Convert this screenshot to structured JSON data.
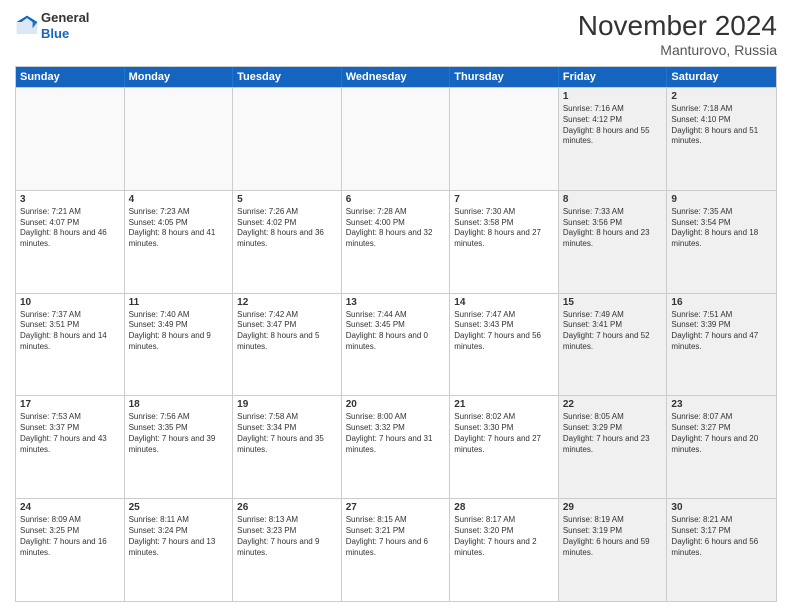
{
  "logo": {
    "general": "General",
    "blue": "Blue"
  },
  "header": {
    "month": "November 2024",
    "location": "Manturovo, Russia"
  },
  "weekdays": [
    "Sunday",
    "Monday",
    "Tuesday",
    "Wednesday",
    "Thursday",
    "Friday",
    "Saturday"
  ],
  "rows": [
    [
      {
        "day": "",
        "sunrise": "",
        "sunset": "",
        "daylight": "",
        "empty": true
      },
      {
        "day": "",
        "sunrise": "",
        "sunset": "",
        "daylight": "",
        "empty": true
      },
      {
        "day": "",
        "sunrise": "",
        "sunset": "",
        "daylight": "",
        "empty": true
      },
      {
        "day": "",
        "sunrise": "",
        "sunset": "",
        "daylight": "",
        "empty": true
      },
      {
        "day": "",
        "sunrise": "",
        "sunset": "",
        "daylight": "",
        "empty": true
      },
      {
        "day": "1",
        "sunrise": "Sunrise: 7:16 AM",
        "sunset": "Sunset: 4:12 PM",
        "daylight": "Daylight: 8 hours and 55 minutes.",
        "empty": false,
        "shaded": true
      },
      {
        "day": "2",
        "sunrise": "Sunrise: 7:18 AM",
        "sunset": "Sunset: 4:10 PM",
        "daylight": "Daylight: 8 hours and 51 minutes.",
        "empty": false,
        "shaded": true
      }
    ],
    [
      {
        "day": "3",
        "sunrise": "Sunrise: 7:21 AM",
        "sunset": "Sunset: 4:07 PM",
        "daylight": "Daylight: 8 hours and 46 minutes.",
        "empty": false,
        "shaded": false
      },
      {
        "day": "4",
        "sunrise": "Sunrise: 7:23 AM",
        "sunset": "Sunset: 4:05 PM",
        "daylight": "Daylight: 8 hours and 41 minutes.",
        "empty": false,
        "shaded": false
      },
      {
        "day": "5",
        "sunrise": "Sunrise: 7:26 AM",
        "sunset": "Sunset: 4:02 PM",
        "daylight": "Daylight: 8 hours and 36 minutes.",
        "empty": false,
        "shaded": false
      },
      {
        "day": "6",
        "sunrise": "Sunrise: 7:28 AM",
        "sunset": "Sunset: 4:00 PM",
        "daylight": "Daylight: 8 hours and 32 minutes.",
        "empty": false,
        "shaded": false
      },
      {
        "day": "7",
        "sunrise": "Sunrise: 7:30 AM",
        "sunset": "Sunset: 3:58 PM",
        "daylight": "Daylight: 8 hours and 27 minutes.",
        "empty": false,
        "shaded": false
      },
      {
        "day": "8",
        "sunrise": "Sunrise: 7:33 AM",
        "sunset": "Sunset: 3:56 PM",
        "daylight": "Daylight: 8 hours and 23 minutes.",
        "empty": false,
        "shaded": true
      },
      {
        "day": "9",
        "sunrise": "Sunrise: 7:35 AM",
        "sunset": "Sunset: 3:54 PM",
        "daylight": "Daylight: 8 hours and 18 minutes.",
        "empty": false,
        "shaded": true
      }
    ],
    [
      {
        "day": "10",
        "sunrise": "Sunrise: 7:37 AM",
        "sunset": "Sunset: 3:51 PM",
        "daylight": "Daylight: 8 hours and 14 minutes.",
        "empty": false,
        "shaded": false
      },
      {
        "day": "11",
        "sunrise": "Sunrise: 7:40 AM",
        "sunset": "Sunset: 3:49 PM",
        "daylight": "Daylight: 8 hours and 9 minutes.",
        "empty": false,
        "shaded": false
      },
      {
        "day": "12",
        "sunrise": "Sunrise: 7:42 AM",
        "sunset": "Sunset: 3:47 PM",
        "daylight": "Daylight: 8 hours and 5 minutes.",
        "empty": false,
        "shaded": false
      },
      {
        "day": "13",
        "sunrise": "Sunrise: 7:44 AM",
        "sunset": "Sunset: 3:45 PM",
        "daylight": "Daylight: 8 hours and 0 minutes.",
        "empty": false,
        "shaded": false
      },
      {
        "day": "14",
        "sunrise": "Sunrise: 7:47 AM",
        "sunset": "Sunset: 3:43 PM",
        "daylight": "Daylight: 7 hours and 56 minutes.",
        "empty": false,
        "shaded": false
      },
      {
        "day": "15",
        "sunrise": "Sunrise: 7:49 AM",
        "sunset": "Sunset: 3:41 PM",
        "daylight": "Daylight: 7 hours and 52 minutes.",
        "empty": false,
        "shaded": true
      },
      {
        "day": "16",
        "sunrise": "Sunrise: 7:51 AM",
        "sunset": "Sunset: 3:39 PM",
        "daylight": "Daylight: 7 hours and 47 minutes.",
        "empty": false,
        "shaded": true
      }
    ],
    [
      {
        "day": "17",
        "sunrise": "Sunrise: 7:53 AM",
        "sunset": "Sunset: 3:37 PM",
        "daylight": "Daylight: 7 hours and 43 minutes.",
        "empty": false,
        "shaded": false
      },
      {
        "day": "18",
        "sunrise": "Sunrise: 7:56 AM",
        "sunset": "Sunset: 3:35 PM",
        "daylight": "Daylight: 7 hours and 39 minutes.",
        "empty": false,
        "shaded": false
      },
      {
        "day": "19",
        "sunrise": "Sunrise: 7:58 AM",
        "sunset": "Sunset: 3:34 PM",
        "daylight": "Daylight: 7 hours and 35 minutes.",
        "empty": false,
        "shaded": false
      },
      {
        "day": "20",
        "sunrise": "Sunrise: 8:00 AM",
        "sunset": "Sunset: 3:32 PM",
        "daylight": "Daylight: 7 hours and 31 minutes.",
        "empty": false,
        "shaded": false
      },
      {
        "day": "21",
        "sunrise": "Sunrise: 8:02 AM",
        "sunset": "Sunset: 3:30 PM",
        "daylight": "Daylight: 7 hours and 27 minutes.",
        "empty": false,
        "shaded": false
      },
      {
        "day": "22",
        "sunrise": "Sunrise: 8:05 AM",
        "sunset": "Sunset: 3:29 PM",
        "daylight": "Daylight: 7 hours and 23 minutes.",
        "empty": false,
        "shaded": true
      },
      {
        "day": "23",
        "sunrise": "Sunrise: 8:07 AM",
        "sunset": "Sunset: 3:27 PM",
        "daylight": "Daylight: 7 hours and 20 minutes.",
        "empty": false,
        "shaded": true
      }
    ],
    [
      {
        "day": "24",
        "sunrise": "Sunrise: 8:09 AM",
        "sunset": "Sunset: 3:25 PM",
        "daylight": "Daylight: 7 hours and 16 minutes.",
        "empty": false,
        "shaded": false
      },
      {
        "day": "25",
        "sunrise": "Sunrise: 8:11 AM",
        "sunset": "Sunset: 3:24 PM",
        "daylight": "Daylight: 7 hours and 13 minutes.",
        "empty": false,
        "shaded": false
      },
      {
        "day": "26",
        "sunrise": "Sunrise: 8:13 AM",
        "sunset": "Sunset: 3:23 PM",
        "daylight": "Daylight: 7 hours and 9 minutes.",
        "empty": false,
        "shaded": false
      },
      {
        "day": "27",
        "sunrise": "Sunrise: 8:15 AM",
        "sunset": "Sunset: 3:21 PM",
        "daylight": "Daylight: 7 hours and 6 minutes.",
        "empty": false,
        "shaded": false
      },
      {
        "day": "28",
        "sunrise": "Sunrise: 8:17 AM",
        "sunset": "Sunset: 3:20 PM",
        "daylight": "Daylight: 7 hours and 2 minutes.",
        "empty": false,
        "shaded": false
      },
      {
        "day": "29",
        "sunrise": "Sunrise: 8:19 AM",
        "sunset": "Sunset: 3:19 PM",
        "daylight": "Daylight: 6 hours and 59 minutes.",
        "empty": false,
        "shaded": true
      },
      {
        "day": "30",
        "sunrise": "Sunrise: 8:21 AM",
        "sunset": "Sunset: 3:17 PM",
        "daylight": "Daylight: 6 hours and 56 minutes.",
        "empty": false,
        "shaded": true
      }
    ]
  ]
}
